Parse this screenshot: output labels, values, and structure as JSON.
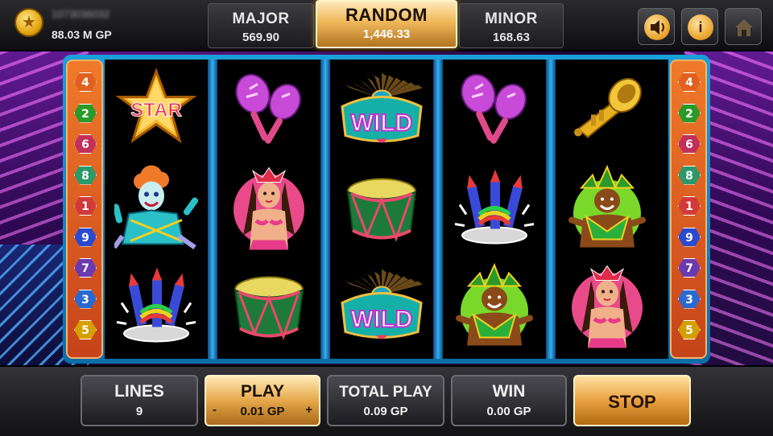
{
  "player": {
    "account_id": "1073036032",
    "balance": "88.03 M GP"
  },
  "jackpots": {
    "major": {
      "label": "MAJOR",
      "value": "569.90"
    },
    "random": {
      "label": "RANDOM",
      "value": "1,446.33"
    },
    "minor": {
      "label": "MINOR",
      "value": "168.63"
    }
  },
  "header_buttons": {
    "sound_icon": "speaker-icon",
    "info_label": "i",
    "home_icon": "home-icon"
  },
  "paylines_left": [
    "4",
    "2",
    "6",
    "8",
    "1",
    "9",
    "7",
    "3",
    "5"
  ],
  "paylines_right": [
    "4",
    "2",
    "6",
    "8",
    "1",
    "9",
    "7",
    "3",
    "5"
  ],
  "payline_colors": {
    "1": "#d23a3a",
    "2": "#2a9a2a",
    "3": "#2a6ad0",
    "4": "#e06020",
    "5": "#d4a000",
    "6": "#c0305a",
    "7": "#6a3ab0",
    "8": "#2a9a6a",
    "9": "#2a4ad0"
  },
  "reels": [
    [
      "star",
      "clown",
      "fireworks"
    ],
    [
      "maracas",
      "dancer",
      "drum"
    ],
    [
      "wild",
      "drum",
      "wild"
    ],
    [
      "maracas",
      "fireworks",
      "carnival-man"
    ],
    [
      "trumpet",
      "carnival-man",
      "dancer"
    ]
  ],
  "symbol_text": {
    "star": "STAR",
    "wild": "WILD"
  },
  "controls": {
    "lines": {
      "label": "LINES",
      "value": "9"
    },
    "play": {
      "label": "PLAY",
      "value": "0.01 GP",
      "minus": "-",
      "plus": "+"
    },
    "total_play": {
      "label": "TOTAL PLAY",
      "value": "0.09 GP"
    },
    "win": {
      "label": "WIN",
      "value": "0.00 GP"
    },
    "stop": {
      "label": "STOP"
    }
  }
}
